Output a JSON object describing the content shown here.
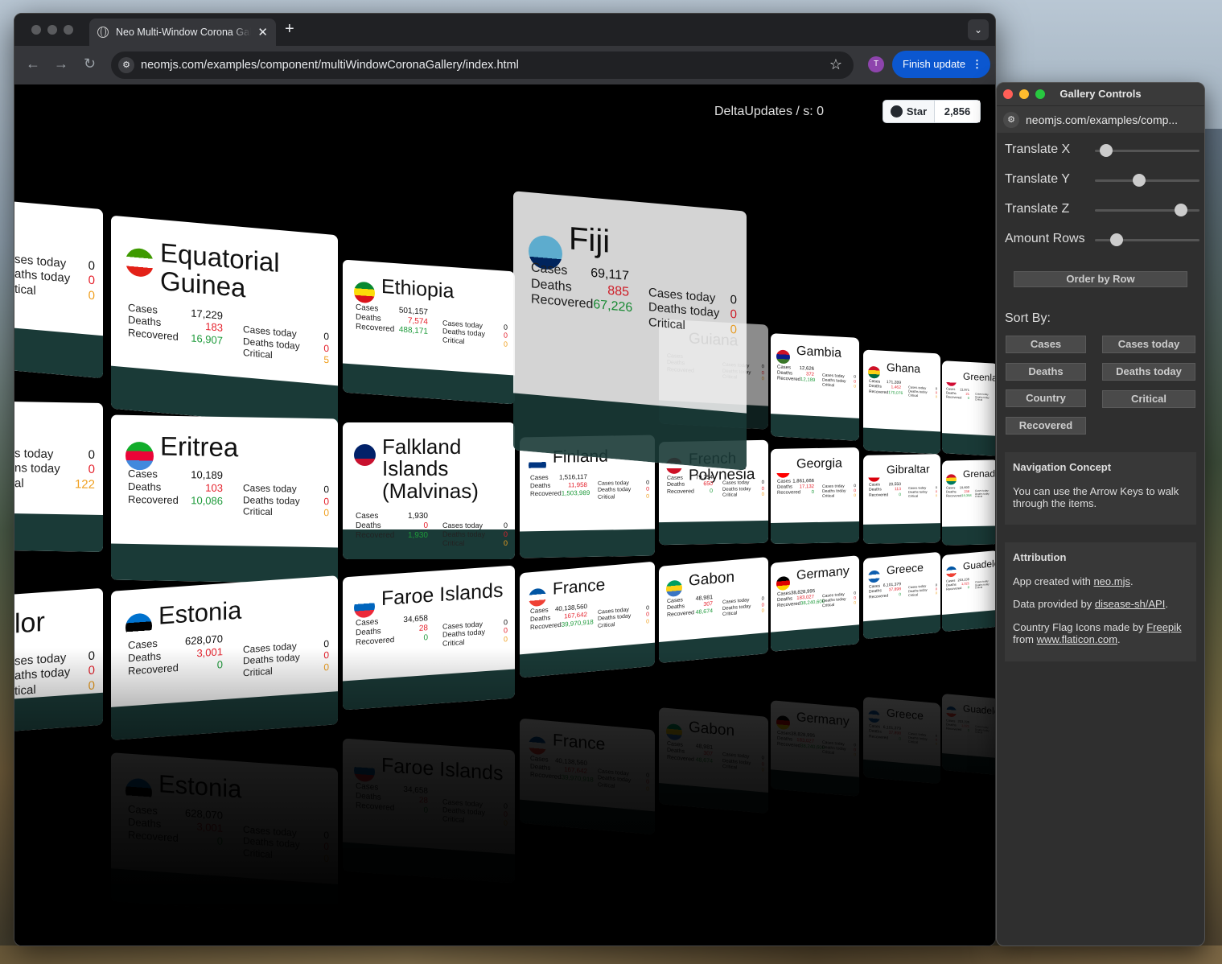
{
  "browser": {
    "tab_title": "Neo Multi-Window Corona Gallery",
    "tab_close": "✕",
    "new_tab": "+",
    "tab_menu": "⌄",
    "back": "←",
    "forward": "→",
    "reload": "↻",
    "url": "neomjs.com/examples/component/multiWindowCoronaGallery/index.html",
    "bookmark": "☆",
    "avatar": "T",
    "finish_update": "Finish update",
    "finish_menu": "⋮"
  },
  "header": {
    "delta_updates": "DeltaUpdates / s: 0",
    "github_star": "Star",
    "github_count": "2,856"
  },
  "gallery": {
    "cards": [
      {
        "country": "Equatorial Guinea",
        "cases": "17,229",
        "deaths": "183",
        "recovered": "16,907",
        "cases_today": "0",
        "deaths_today": "0",
        "critical": "5",
        "flag": [
          "#3e9a00",
          "#fff",
          "#e32118"
        ]
      },
      {
        "country": "Ethiopia",
        "cases": "501,157",
        "deaths": "7,574",
        "recovered": "488,171",
        "cases_today": "0",
        "deaths_today": "0",
        "critical": "0",
        "flag": [
          "#078930",
          "#fcdd09",
          "#da121a"
        ]
      },
      {
        "country": "Fiji",
        "cases": "69,117",
        "deaths": "885",
        "recovered": "67,226",
        "cases_today": "0",
        "deaths_today": "0",
        "critical": "0",
        "flag": [
          "#68bfe5",
          "#68bfe5",
          "#002868"
        ]
      },
      {
        "country": "Eritrea",
        "cases": "10,189",
        "deaths": "103",
        "recovered": "10,086",
        "cases_today": "0",
        "deaths_today": "0",
        "critical": "0",
        "flag": [
          "#12ad2b",
          "#ea0437",
          "#4189dd"
        ]
      },
      {
        "country": "Falkland Islands (Malvinas)",
        "cases": "1,930",
        "deaths": "0",
        "recovered": "1,930",
        "cases_today": "0",
        "deaths_today": "0",
        "critical": "0",
        "flag": [
          "#012169",
          "#012169",
          "#c8102e"
        ]
      },
      {
        "country": "Finland",
        "cases": "1,516,117",
        "deaths": "11,958",
        "recovered": "1,503,989",
        "cases_today": "0",
        "deaths_today": "0",
        "critical": "0",
        "flag": [
          "#fff",
          "#003580",
          "#fff"
        ]
      },
      {
        "country": "French Polynesia",
        "cases": "79,254",
        "deaths": "650",
        "recovered": "0",
        "cases_today": "0",
        "deaths_today": "0",
        "critical": "0",
        "flag": [
          "#ce1126",
          "#fff",
          "#ce1126"
        ]
      },
      {
        "country": "Estonia",
        "cases": "628,070",
        "deaths": "3,001",
        "recovered": "0",
        "cases_today": "0",
        "deaths_today": "0",
        "critical": "0",
        "flag": [
          "#0072ce",
          "#000",
          "#fff"
        ]
      },
      {
        "country": "Faroe Islands",
        "cases": "34,658",
        "deaths": "28",
        "recovered": "0",
        "cases_today": "0",
        "deaths_today": "0",
        "critical": "0",
        "flag": [
          "#fff",
          "#0065bd",
          "#ed2939"
        ]
      },
      {
        "country": "France",
        "cases": "40,138,560",
        "deaths": "167,642",
        "recovered": "39,970,918",
        "cases_today": "0",
        "deaths_today": "0",
        "critical": "0",
        "flag": [
          "#0055a4",
          "#fff",
          "#ef4135"
        ]
      },
      {
        "country": "Gabon",
        "cases": "48,981",
        "deaths": "307",
        "recovered": "48,674",
        "cases_today": "0",
        "deaths_today": "0",
        "critical": "0",
        "flag": [
          "#009e60",
          "#fcd116",
          "#3a75c4"
        ]
      },
      {
        "country": "Gambia",
        "cases": "12,626",
        "deaths": "372",
        "recovered": "12,189",
        "cases_today": "0",
        "deaths_today": "0",
        "critical": "0",
        "flag": [
          "#ce1126",
          "#0c1c8c",
          "#3a7728"
        ]
      },
      {
        "country": "Ghana",
        "cases": "171,289",
        "deaths": "1,462",
        "recovered": "170,076",
        "cases_today": "0",
        "deaths_today": "0",
        "critical": "0",
        "flag": [
          "#ce1126",
          "#fcd116",
          "#006b3f"
        ]
      },
      {
        "country": "Greenland",
        "cases": "11,971",
        "deaths": "21",
        "recovered": "0",
        "cases_today": "0",
        "deaths_today": "0",
        "critical": "0",
        "flag": [
          "#fff",
          "#fff",
          "#d00c33"
        ]
      },
      {
        "country": "Georgia",
        "cases": "1,861,666",
        "deaths": "17,132",
        "recovered": "0",
        "cases_today": "0",
        "deaths_today": "0",
        "critical": "0",
        "flag": [
          "#fff",
          "#fff",
          "#ff0000"
        ]
      },
      {
        "country": "Gibraltar",
        "cases": "20,550",
        "deaths": "113",
        "recovered": "0",
        "cases_today": "0",
        "deaths_today": "0",
        "critical": "0",
        "flag": [
          "#fff",
          "#fff",
          "#da000c"
        ]
      },
      {
        "country": "Grenada",
        "cases": "19,693",
        "deaths": "238",
        "recovered": "19,358",
        "cases_today": "0",
        "deaths_today": "0",
        "critical": "0",
        "flag": [
          "#ce1126",
          "#fcd116",
          "#007a5e"
        ]
      },
      {
        "country": "Germany",
        "cases": "38,828,995",
        "deaths": "183,027",
        "recovered": "38,240,600",
        "cases_today": "0",
        "deaths_today": "0",
        "critical": "0",
        "flag": [
          "#000",
          "#dd0000",
          "#ffce00"
        ]
      },
      {
        "country": "Greece",
        "cases": "6,101,379",
        "deaths": "37,898",
        "recovered": "0",
        "cases_today": "0",
        "deaths_today": "0",
        "critical": "0",
        "flag": [
          "#0d5eaf",
          "#fff",
          "#0d5eaf"
        ]
      },
      {
        "country": "Guadeloupe",
        "cases": "203,235",
        "deaths": "1,021",
        "recovered": "0",
        "cases_today": "0",
        "deaths_today": "0",
        "critical": "0",
        "flag": [
          "#0055a4",
          "#fff",
          "#ef4135"
        ]
      },
      {
        "country": "Guiana",
        "cases": "",
        "deaths": "",
        "recovered": "",
        "cases_today": "0",
        "deaths_today": "0",
        "critical": "0",
        "flag": [
          "#fff",
          "#fff",
          "#fff"
        ]
      },
      {
        "country": "lor",
        "cases": "",
        "deaths": "",
        "recovered": "",
        "cases_today": "0",
        "deaths_today": "0",
        "critical": "0",
        "flag": [
          "#fff",
          "#fff",
          "#fff"
        ]
      }
    ],
    "labels": {
      "cases": "Cases",
      "deaths": "Deaths",
      "recovered": "Recovered",
      "cases_today": "Cases today",
      "deaths_today": "Deaths today",
      "critical": "Critical"
    },
    "partial": {
      "cases_today": "ses today",
      "deaths_today": "aths today",
      "critical": "tical",
      "cases_today_b": "s today",
      "deaths_today_b": "ns today",
      "critical_b": "al"
    }
  },
  "controls": {
    "title": "Gallery Controls",
    "url": "neomjs.com/examples/comp...",
    "sliders": [
      {
        "label": "Translate X",
        "value": 0.05
      },
      {
        "label": "Translate Y",
        "value": 0.38
      },
      {
        "label": "Translate Z",
        "value": 0.8
      },
      {
        "label": "Amount Rows",
        "value": 0.15
      }
    ],
    "order_by_row": "Order by Row",
    "sort_by": "Sort By:",
    "sort_buttons": [
      "Cases",
      "Cases today",
      "Deaths",
      "Deaths today",
      "Country",
      "Critical",
      "Recovered"
    ],
    "nav_concept": {
      "title": "Navigation Concept",
      "text": "You can use the Arrow Keys to walk through the items."
    },
    "attribution": {
      "title": "Attribution",
      "app_prefix": "App created with ",
      "app_link": "neo.mjs",
      "data_prefix": "Data provided by ",
      "data_link": "disease-sh/API",
      "icons_prefix": "Country Flag Icons made by ",
      "icons_link": "Freepik",
      "from": "from ",
      "flaticon_link": "www.flaticon.com",
      "period": "."
    }
  }
}
